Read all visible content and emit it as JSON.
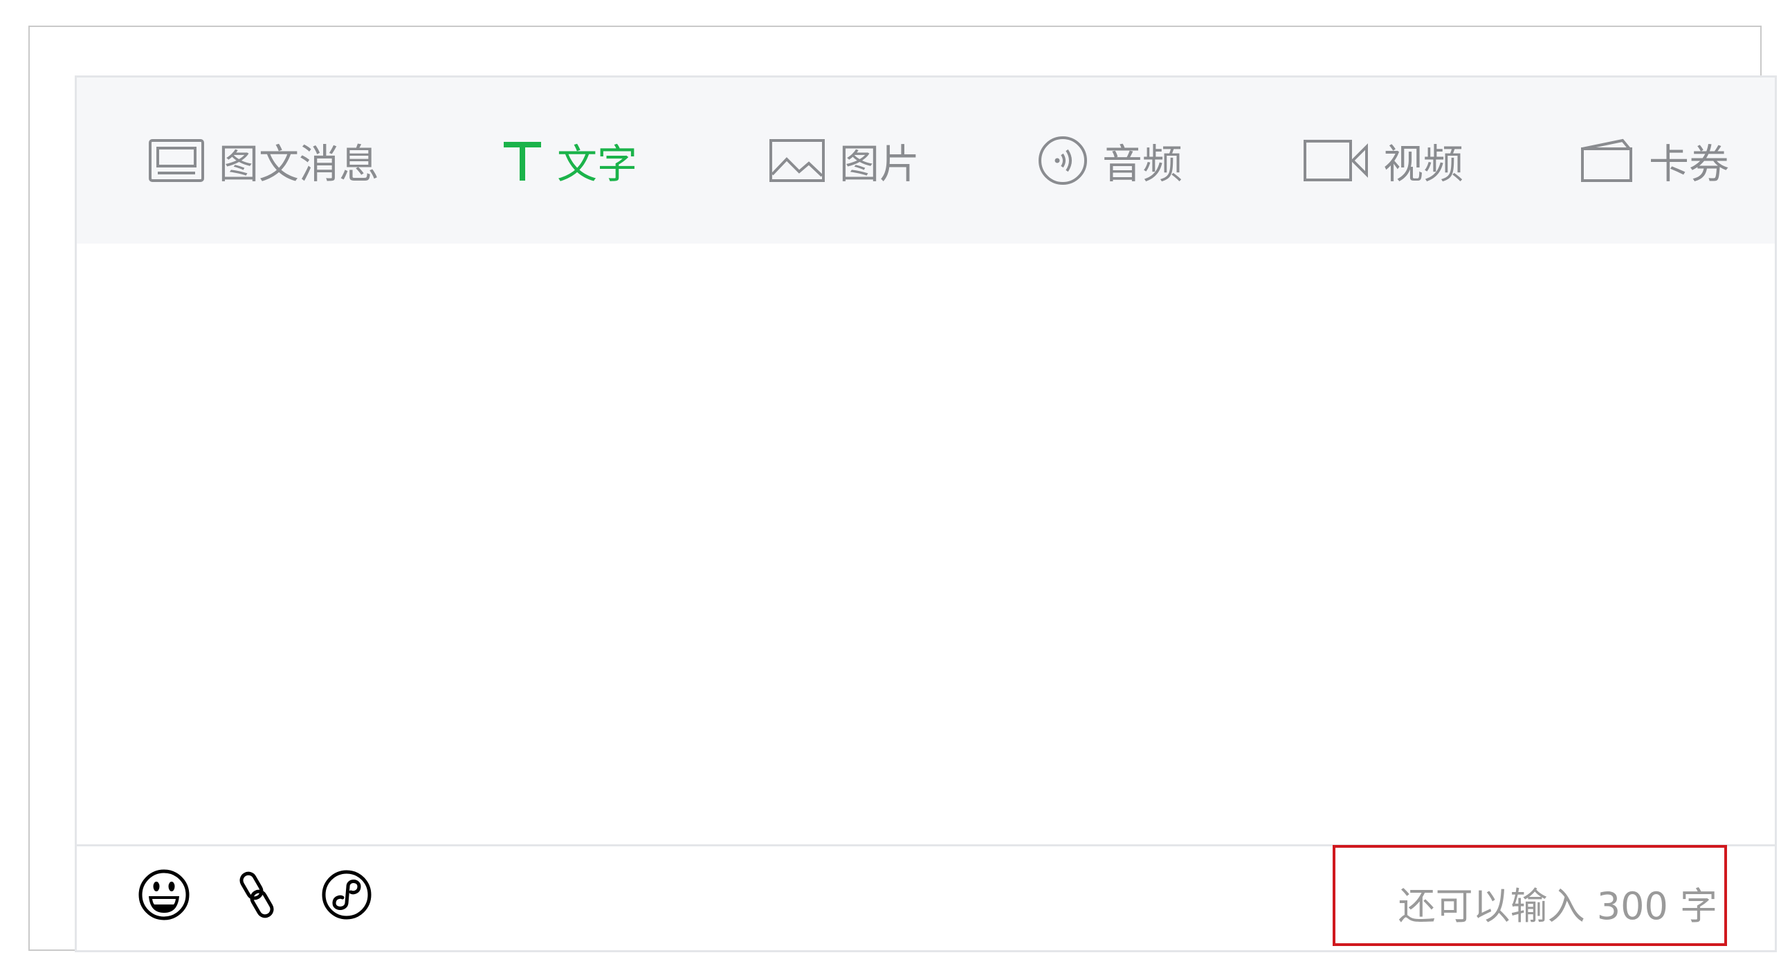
{
  "tabs": [
    {
      "label": "图文消息",
      "icon": "article-icon",
      "active": false
    },
    {
      "label": "文字",
      "icon": "text-icon",
      "active": true
    },
    {
      "label": "图片",
      "icon": "image-icon",
      "active": false
    },
    {
      "label": "音频",
      "icon": "audio-icon",
      "active": false
    },
    {
      "label": "视频",
      "icon": "video-icon",
      "active": false
    },
    {
      "label": "卡券",
      "icon": "card-icon",
      "active": false
    }
  ],
  "toolbar": {
    "emoji_icon": "emoji-icon",
    "link_icon": "link-icon",
    "mini_program_icon": "mini-program-icon"
  },
  "counter": {
    "text": "还可以输入 300 字",
    "remaining": 300
  },
  "colors": {
    "accent": "#1bb34a",
    "tab_text": "#8a8c90",
    "highlight_border": "#d0181e",
    "tabbar_bg": "#f6f7f9"
  }
}
